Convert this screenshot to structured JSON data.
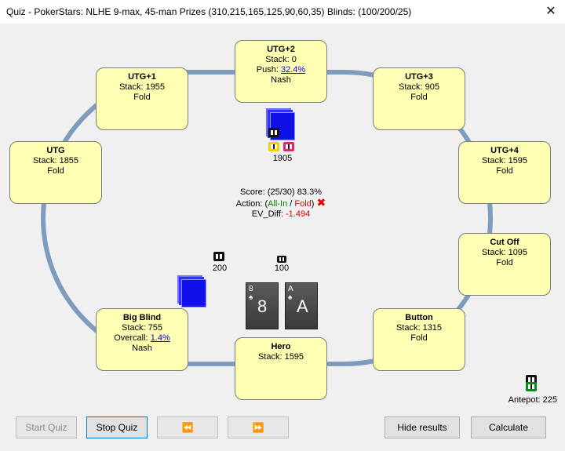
{
  "window": {
    "title": "Quiz - PokerStars: NLHE 9-max, 45-man Prizes (310,215,165,125,90,60,35) Blinds: (100/200/25)",
    "close_glyph": "✕"
  },
  "seats": {
    "utg2": {
      "name": "UTG+2",
      "stack": "Stack: 0",
      "action_prefix": "Push: ",
      "action_link": "32.4%",
      "line3": "Nash"
    },
    "utg1": {
      "name": "UTG+1",
      "stack": "Stack: 1955",
      "line3": "Fold"
    },
    "utg3": {
      "name": "UTG+3",
      "stack": "Stack: 905",
      "line3": "Fold"
    },
    "utg": {
      "name": "UTG",
      "stack": "Stack: 1855",
      "line3": "Fold"
    },
    "utg4": {
      "name": "UTG+4",
      "stack": "Stack: 1595",
      "line3": "Fold"
    },
    "cutoff": {
      "name": "Cut Off",
      "stack": "Stack: 1095",
      "line3": "Fold"
    },
    "bigblind": {
      "name": "Big Blind",
      "stack": "Stack: 755",
      "action_prefix": "Overcall: ",
      "action_link": "1.4%",
      "line3": "Nash"
    },
    "button": {
      "name": "Button",
      "stack": "Stack: 1315",
      "line3": "Fold"
    },
    "hero": {
      "name": "Hero",
      "stack": "Stack: 1595"
    }
  },
  "bets": {
    "utg2_bet": "1905",
    "bb_bet": "200",
    "sb_bet": "100"
  },
  "center": {
    "score": "Score: (25/30) 83.3%",
    "action_prefix": "Action: (",
    "action_allin": "All-In",
    "action_sep": " / ",
    "action_fold": "Fold",
    "action_suffix": ")",
    "wrong_mark": "✖",
    "ev_label": "EV_Diff: ",
    "ev_value": "-1.494"
  },
  "hero_cards": [
    {
      "rank": "8",
      "suit": "♠"
    },
    {
      "rank": "A",
      "suit": "♠"
    }
  ],
  "antepot": "Antepot: 225",
  "buttons": {
    "start_quiz": "Start Quiz",
    "stop_quiz": "Stop Quiz",
    "prev": "⏪",
    "next": "⏩",
    "hide_results": "Hide results",
    "calculate": "Calculate"
  },
  "colors": {
    "seat_bg": "#ffffb4",
    "table_rail": "#7f9bbd",
    "all_in": "#008000",
    "fold": "#e00000",
    "ev_negative": "#e00000",
    "deck_blue": "#1010e8"
  }
}
